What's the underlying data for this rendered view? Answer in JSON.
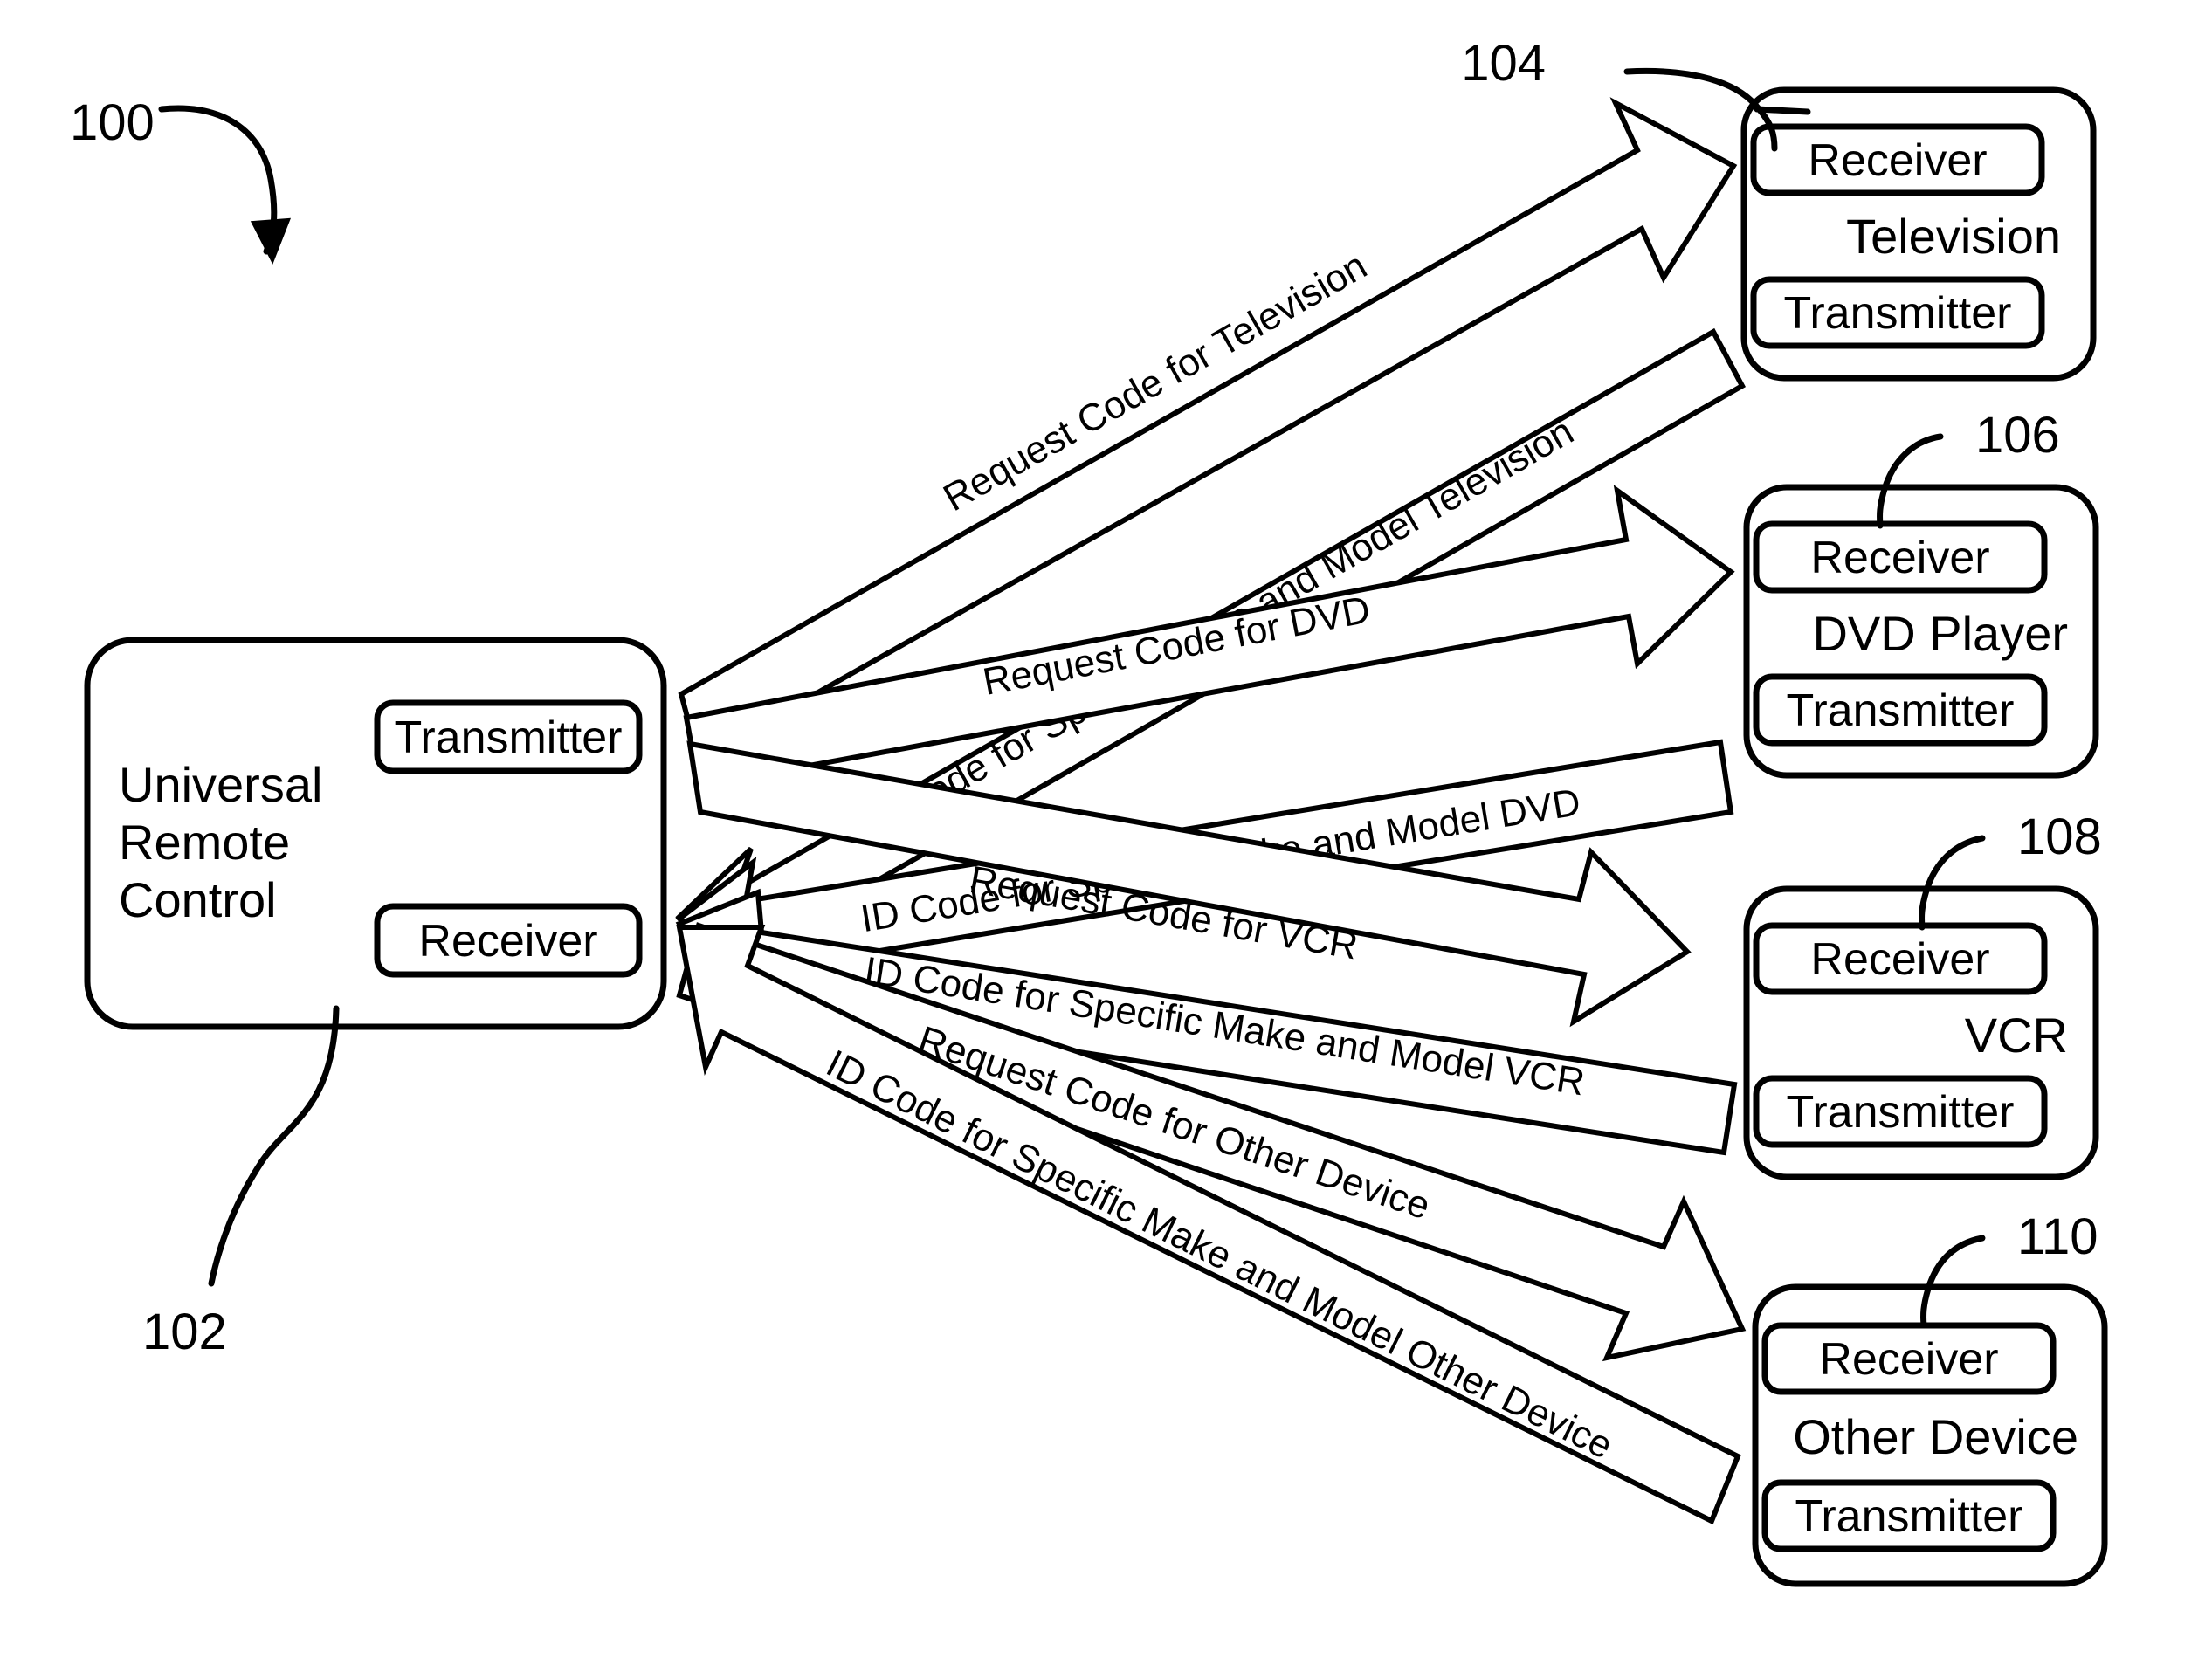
{
  "figure": {
    "id_label": "100",
    "remote_ref": "102"
  },
  "remote": {
    "name": "Universal Remote Control",
    "name_lines": [
      "Universal",
      "Remote",
      "Control"
    ],
    "transmitter_label": "Transmitter",
    "receiver_label": "Receiver",
    "ref": "102"
  },
  "devices": [
    {
      "ref": "104",
      "title": "Television",
      "receiver_label": "Receiver",
      "transmitter_label": "Transmitter"
    },
    {
      "ref": "106",
      "title": "DVD Player",
      "receiver_label": "Receiver",
      "transmitter_label": "Transmitter"
    },
    {
      "ref": "108",
      "title": "VCR",
      "receiver_label": "Receiver",
      "transmitter_label": "Transmitter"
    },
    {
      "ref": "110",
      "title": "Other Device",
      "receiver_label": "Receiver",
      "transmitter_label": "Transmitter"
    }
  ],
  "messages": {
    "request_television": "Request Code for Television",
    "idcode_television": "ID Code for Specific Make and Model Television",
    "request_dvd": "Request Code for DVD",
    "idcode_dvd": "ID Code for Specific Make and Model DVD",
    "request_vcr": "Request Code for VCR",
    "idcode_vcr": "ID Code for Specific Make and Model VCR",
    "request_other": "Request Code for Other Device",
    "idcode_other": "ID Code for Specific Make and Model Other Device"
  },
  "colors": {
    "ink": "#000000",
    "paper": "#ffffff"
  }
}
